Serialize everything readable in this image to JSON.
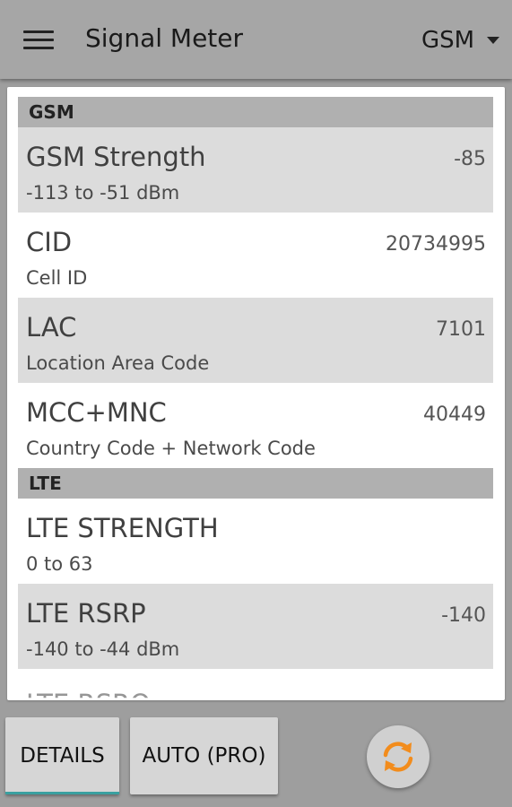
{
  "appbar": {
    "title": "Signal Meter",
    "network_selected": "GSM",
    "menu_icon": "hamburger-menu-icon",
    "dropdown_icon": "dropdown-arrow-icon"
  },
  "sections": {
    "gsm": {
      "header": "GSM",
      "rows": [
        {
          "title": "GSM Strength",
          "subtitle": "-113 to -51 dBm",
          "value": "-85"
        },
        {
          "title": "CID",
          "subtitle": "Cell ID",
          "value": "20734995"
        },
        {
          "title": "LAC",
          "subtitle": "Location Area Code",
          "value": "7101"
        },
        {
          "title": "MCC+MNC",
          "subtitle": "Country Code + Network Code",
          "value": "40449"
        }
      ]
    },
    "lte": {
      "header": "LTE",
      "rows": [
        {
          "title": "LTE STRENGTH",
          "subtitle": "0 to 63",
          "value": ""
        },
        {
          "title": "LTE RSRP",
          "subtitle": "-140 to -44 dBm",
          "value": "-140"
        }
      ],
      "partial_row_title": "LTE RSRQ"
    }
  },
  "bottombar": {
    "details_label": "DETAILS",
    "auto_label": "AUTO (PRO)",
    "refresh_icon": "refresh-icon"
  },
  "colors": {
    "appbar": "#a6a6a6",
    "section_header": "#b0b0b0",
    "row_shaded": "#dcdcdc",
    "refresh_orange": "#f28c1c",
    "tab_indicator": "#3aa0a0"
  }
}
